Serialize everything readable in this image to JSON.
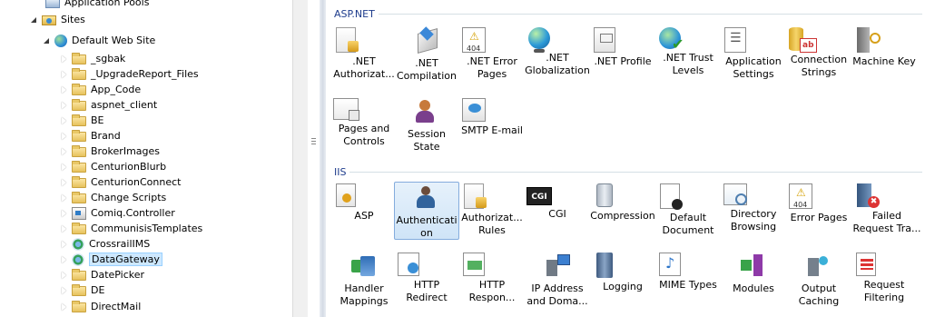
{
  "tree": {
    "items": [
      {
        "label": "Application Pools",
        "icon": "application-pools-icon",
        "expander": "none"
      },
      {
        "label": "Sites",
        "icon": "sites-icon",
        "expander": "open"
      },
      {
        "label": "Default Web Site",
        "icon": "website-globe-icon",
        "expander": "open"
      },
      {
        "label": "_sgbak",
        "icon": "folder-icon",
        "expander": "closed"
      },
      {
        "label": "_UpgradeReport_Files",
        "icon": "folder-icon",
        "expander": "closed"
      },
      {
        "label": "App_Code",
        "icon": "folder-icon",
        "expander": "closed"
      },
      {
        "label": "aspnet_client",
        "icon": "folder-icon",
        "expander": "closed"
      },
      {
        "label": "BE",
        "icon": "folder-icon",
        "expander": "closed"
      },
      {
        "label": "Brand",
        "icon": "folder-icon",
        "expander": "closed"
      },
      {
        "label": "BrokerImages",
        "icon": "folder-icon",
        "expander": "closed"
      },
      {
        "label": "CenturionBlurb",
        "icon": "folder-icon",
        "expander": "closed"
      },
      {
        "label": "CenturionConnect",
        "icon": "folder-icon",
        "expander": "closed"
      },
      {
        "label": "Change Scripts",
        "icon": "folder-icon",
        "expander": "closed"
      },
      {
        "label": "Comiq.Controller",
        "icon": "application-icon",
        "expander": "closed"
      },
      {
        "label": "CommunisisTemplates",
        "icon": "folder-icon",
        "expander": "closed"
      },
      {
        "label": "CrossrailIMS",
        "icon": "web-app-icon",
        "expander": "closed"
      },
      {
        "label": "DataGateway",
        "icon": "web-app-icon",
        "expander": "closed",
        "selected": true
      },
      {
        "label": "DatePicker",
        "icon": "folder-icon",
        "expander": "closed"
      },
      {
        "label": "DE",
        "icon": "folder-icon",
        "expander": "closed"
      },
      {
        "label": "DirectMail",
        "icon": "folder-icon",
        "expander": "closed"
      }
    ]
  },
  "groups": [
    {
      "title": "ASP.NET",
      "features": [
        {
          "line1": ".NET",
          "line2": "Authorizat...",
          "icon": "doc-lock-icon"
        },
        {
          "line1": ".NET",
          "line2": "Compilation",
          "icon": "compilation-icon"
        },
        {
          "line1": ".NET Error",
          "line2": "Pages",
          "icon": "error-404-icon"
        },
        {
          "line1": ".NET",
          "line2": "Globalization",
          "icon": "globe-icon"
        },
        {
          "line1": ".NET Profile",
          "line2": "",
          "icon": "profile-icon"
        },
        {
          "line1": ".NET Trust",
          "line2": "Levels",
          "icon": "trust-globe-icon"
        },
        {
          "line1": "Application",
          "line2": "Settings",
          "icon": "settings-list-icon"
        },
        {
          "line1": "Connection",
          "line2": "Strings",
          "icon": "database-icon"
        },
        {
          "line1": "Machine Key",
          "line2": "",
          "icon": "machine-key-icon"
        },
        {
          "line1": "Pages and",
          "line2": "Controls",
          "icon": "pages-controls-icon"
        },
        {
          "line1": "Session State",
          "line2": "",
          "icon": "session-state-icon"
        },
        {
          "line1": "SMTP E-mail",
          "line2": "",
          "icon": "smtp-mail-icon"
        }
      ]
    },
    {
      "title": "IIS",
      "features": [
        {
          "line1": "ASP",
          "line2": "",
          "icon": "asp-certificate-icon"
        },
        {
          "line1": "Authenticati",
          "line2": "on",
          "icon": "authentication-users-icon",
          "selected": true
        },
        {
          "line1": "Authorizat...",
          "line2": "Rules",
          "icon": "doc-lock-icon"
        },
        {
          "line1": "CGI",
          "line2": "",
          "icon": "cgi-icon"
        },
        {
          "line1": "Compression",
          "line2": "",
          "icon": "compression-icon"
        },
        {
          "line1": "Default",
          "line2": "Document",
          "icon": "default-document-icon"
        },
        {
          "line1": "Directory",
          "line2": "Browsing",
          "icon": "directory-browsing-icon"
        },
        {
          "line1": "Error Pages",
          "line2": "",
          "icon": "error-404-icon"
        },
        {
          "line1": "Failed",
          "line2": "Request Tra...",
          "icon": "failed-request-icon"
        },
        {
          "line1": "Handler",
          "line2": "Mappings",
          "icon": "handler-mappings-icon"
        },
        {
          "line1": "HTTP",
          "line2": "Redirect",
          "icon": "http-redirect-icon"
        },
        {
          "line1": "HTTP",
          "line2": "Respon...",
          "icon": "http-response-icon"
        },
        {
          "line1": "IP Address",
          "line2": "and Doma...",
          "icon": "ip-address-icon"
        },
        {
          "line1": "Logging",
          "line2": "",
          "icon": "logging-icon"
        },
        {
          "line1": "MIME Types",
          "line2": "",
          "icon": "mime-types-icon"
        },
        {
          "line1": "Modules",
          "line2": "",
          "icon": "modules-icon"
        },
        {
          "line1": "Output",
          "line2": "Caching",
          "icon": "output-caching-icon"
        },
        {
          "line1": "Request",
          "line2": "Filtering",
          "icon": "request-filtering-icon"
        }
      ]
    }
  ],
  "cgi_badge": "CGI",
  "colors": {
    "group_title": "#1e3c8c",
    "selection": "#cde8ff"
  }
}
